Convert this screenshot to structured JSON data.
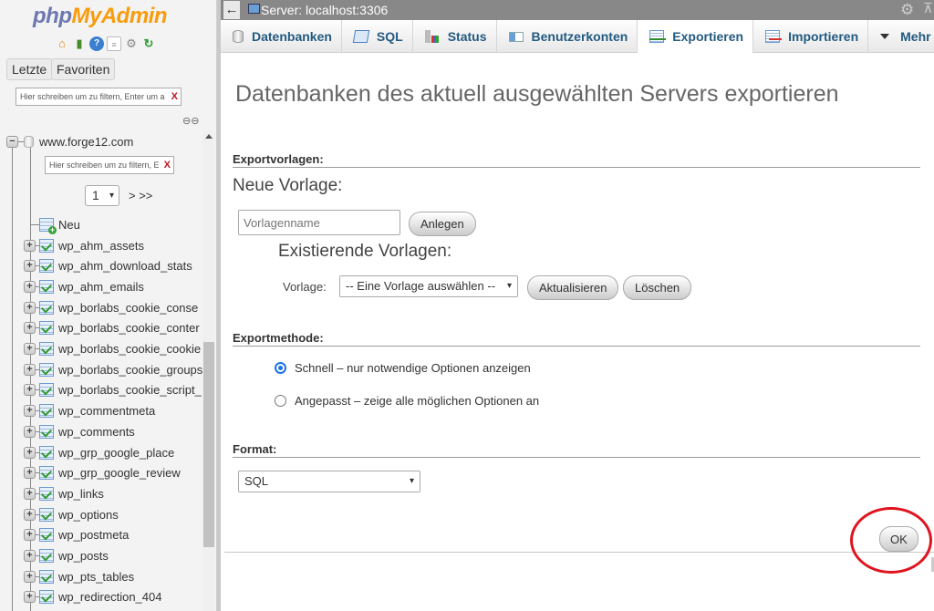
{
  "app": {
    "logo_php": "php",
    "logo_myadmin": "MyAdmin"
  },
  "sidebar": {
    "nav_icons": [
      "home-icon",
      "logout-icon",
      "help-icon",
      "docs-icon",
      "settings-icon",
      "reload-icon"
    ],
    "tabs": [
      {
        "label": "Letzte"
      },
      {
        "label": "Favoriten"
      }
    ],
    "filter_placeholder": "Hier schreiben um zu filtern, Enter um a",
    "clear_glyph": "X",
    "database": {
      "name": "www.forge12.com",
      "filter_placeholder": "Hier schreiben um zu filtern, E",
      "page_select": "1",
      "page_next": "> >>",
      "new_label": "Neu",
      "tables": [
        "wp_ahm_assets",
        "wp_ahm_download_stats",
        "wp_ahm_emails",
        "wp_borlabs_cookie_conse",
        "wp_borlabs_cookie_conter",
        "wp_borlabs_cookie_cookie",
        "wp_borlabs_cookie_groups",
        "wp_borlabs_cookie_script_",
        "wp_commentmeta",
        "wp_comments",
        "wp_grp_google_place",
        "wp_grp_google_review",
        "wp_links",
        "wp_options",
        "wp_postmeta",
        "wp_posts",
        "wp_pts_tables",
        "wp_redirection_404"
      ]
    }
  },
  "topbar": {
    "back_glyph": "←",
    "server_label": "Server: localhost:3306",
    "gear_glyph": "⚙",
    "collapse_glyph": "⊼"
  },
  "tabs": [
    {
      "label": "Datenbanken",
      "icon": "database-icon",
      "active": false
    },
    {
      "label": "SQL",
      "icon": "sql-icon",
      "active": false
    },
    {
      "label": "Status",
      "icon": "status-icon",
      "active": false
    },
    {
      "label": "Benutzerkonten",
      "icon": "users-icon",
      "active": false
    },
    {
      "label": "Exportieren",
      "icon": "export-icon",
      "active": true
    },
    {
      "label": "Importieren",
      "icon": "import-icon",
      "active": false
    },
    {
      "label": "Mehr",
      "icon": "more-icon",
      "active": false
    }
  ],
  "main": {
    "title": "Datenbanken des aktuell ausgewählten Servers exportieren",
    "templates": {
      "section_label": "Exportvorlagen:",
      "new_heading": "Neue Vorlage:",
      "name_placeholder": "Vorlagenname",
      "create_button": "Anlegen",
      "existing_heading": "Existierende Vorlagen:",
      "template_label": "Vorlage:",
      "template_select_value": "-- Eine Vorlage auswählen --",
      "update_button": "Aktualisieren",
      "delete_button": "Löschen"
    },
    "method": {
      "section_label": "Exportmethode:",
      "options": [
        {
          "label": "Schnell – nur notwendige Optionen anzeigen",
          "checked": true
        },
        {
          "label": "Angepasst – zeige alle möglichen Optionen an",
          "checked": false
        }
      ]
    },
    "format": {
      "section_label": "Format:",
      "selected": "SQL"
    },
    "ok_button": "OK"
  },
  "colors": {
    "tab_text": "#235a81",
    "annotation": "#e0141e",
    "radio_checked": "#1a73e8"
  }
}
